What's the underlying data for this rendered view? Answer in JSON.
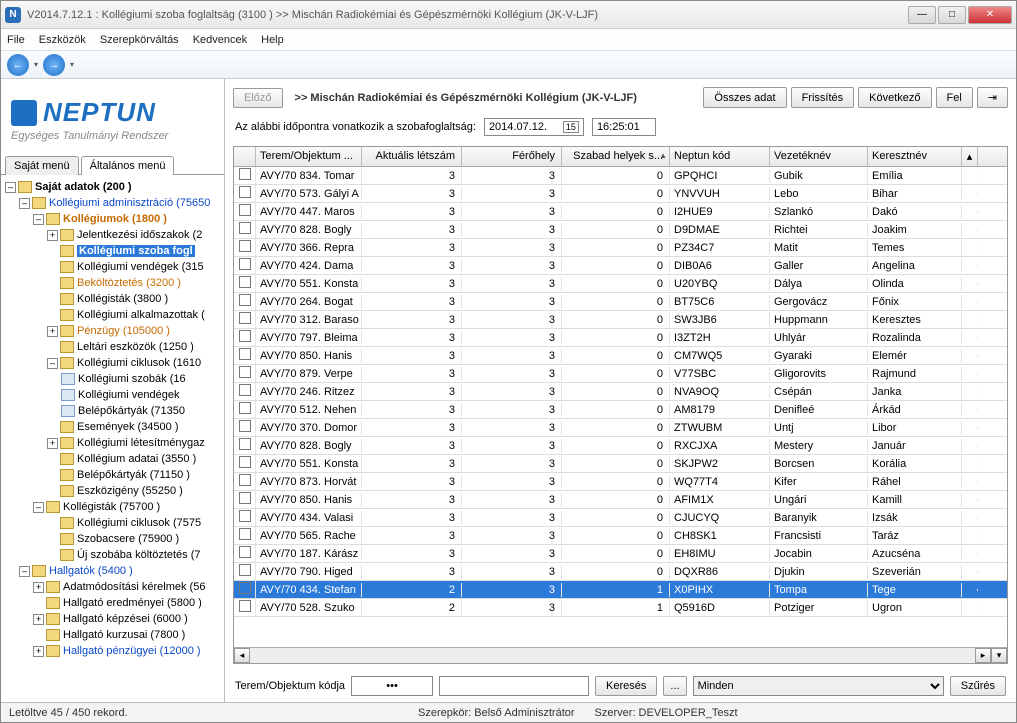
{
  "window": {
    "title": "V2014.7.12.1 : Kollégiumi szoba foglaltság (3100  )  >> Mischán Radiokémiai és Gépészmérnöki Kollégium (JK-V-LJF)"
  },
  "menu": [
    "File",
    "Eszközök",
    "Szerepkörváltás",
    "Kedvencek",
    "Help"
  ],
  "logo": {
    "brand": "NEPTUN",
    "tagline": "Egységes Tanulmányi Rendszer"
  },
  "tabs": {
    "left": "Saját menü",
    "right": "Általános menü"
  },
  "tree": {
    "root": "Saját adatok (200  )",
    "items": [
      "Kollégiumi adminisztráció (75650",
      "Kollégiumok (1800  )",
      "Jelentkezési időszakok (2",
      "Kollégiumi szoba fogl",
      "Kollégiumi vendégek (315",
      "Beköltöztetés (3200  )",
      "Kollégisták (3800  )",
      "Kollégiumi alkalmazottak (",
      "Pénzügy (105000  )",
      "Leltári eszközök (1250  )",
      "Kollégiumi ciklusok (1610",
      "Kollégiumi szobák (16",
      "Kollégiumi vendégek",
      "Belépőkártyák (71350",
      "Események (34500  )",
      "Kollégiumi létesítménygaz",
      "Kollégium adatai (3550  )",
      "Belépőkártyák (71150  )",
      "Eszközigény (55250  )",
      "Kollégisták (75700  )",
      "Kollégiumi ciklusok (7575",
      "Szobacsere (75900  )",
      "Új szobába költöztetés (7",
      "Hallgatók (5400  )",
      "Adatmódosítási kérelmek (56",
      "Hallgató eredményei (5800  )",
      "Hallgató képzései (6000  )",
      "Hallgató kurzusai (7800  )",
      "Hallgató pénzügyei (12000  )"
    ]
  },
  "header": {
    "prev": "Előző",
    "crumb": ">>  Mischán Radiokémiai és Gépészmérnöki Kollégium (JK-V-LJF)",
    "buttons": [
      "Összes adat",
      "Frissítés",
      "Következő",
      "Fel"
    ]
  },
  "dateline": {
    "label": "Az alábbi időpontra vonatkozik a szobafoglaltság:",
    "date": "2014.07.12.",
    "time": "16:25:01"
  },
  "columns": [
    "",
    "Terem/Objektum ...",
    "Aktuális létszám",
    "Férőhely",
    "Szabad helyek s...",
    "Neptun kód",
    "Vezetéknév",
    "Keresztnév"
  ],
  "rows": [
    {
      "t": "AVY/70 834. Tomar",
      "a": 3,
      "f": 3,
      "s": 0,
      "n": "GPQHCI",
      "v": "Gubik",
      "k": "Emília"
    },
    {
      "t": "AVY/70 573. Gályi A",
      "a": 3,
      "f": 3,
      "s": 0,
      "n": "YNVVUH",
      "v": "Lebo",
      "k": "Bihar"
    },
    {
      "t": "AVY/70 447. Maros",
      "a": 3,
      "f": 3,
      "s": 0,
      "n": "I2HUE9",
      "v": "Szlankó",
      "k": "Dakó"
    },
    {
      "t": "AVY/70 828. Bogly",
      "a": 3,
      "f": 3,
      "s": 0,
      "n": "D9DMAE",
      "v": "Richtei",
      "k": "Joakim"
    },
    {
      "t": "AVY/70 366. Repra",
      "a": 3,
      "f": 3,
      "s": 0,
      "n": "PZ34C7",
      "v": "Matit",
      "k": "Temes"
    },
    {
      "t": "AVY/70 424. Dama",
      "a": 3,
      "f": 3,
      "s": 0,
      "n": "DIB0A6",
      "v": "Galler",
      "k": "Angelina"
    },
    {
      "t": "AVY/70 551. Konsta",
      "a": 3,
      "f": 3,
      "s": 0,
      "n": "U20YBQ",
      "v": "Dálya",
      "k": "Olinda"
    },
    {
      "t": "AVY/70 264. Bogat",
      "a": 3,
      "f": 3,
      "s": 0,
      "n": "BT75C6",
      "v": "Gergovácz",
      "k": "Főnix"
    },
    {
      "t": "AVY/70 312. Baraso",
      "a": 3,
      "f": 3,
      "s": 0,
      "n": "SW3JB6",
      "v": "Huppmann",
      "k": "Keresztes"
    },
    {
      "t": "AVY/70 797. Bleima",
      "a": 3,
      "f": 3,
      "s": 0,
      "n": "I3ZT2H",
      "v": "Uhlyár",
      "k": "Rozalinda"
    },
    {
      "t": "AVY/70 850. Hanis",
      "a": 3,
      "f": 3,
      "s": 0,
      "n": "CM7WQ5",
      "v": "Gyaraki",
      "k": "Elemér"
    },
    {
      "t": "AVY/70 879. Verpe",
      "a": 3,
      "f": 3,
      "s": 0,
      "n": "V77SBC",
      "v": "Gligorovits",
      "k": "Rajmund"
    },
    {
      "t": "AVY/70 246. Ritzez",
      "a": 3,
      "f": 3,
      "s": 0,
      "n": "NVA9OQ",
      "v": "Csépán",
      "k": "Janka"
    },
    {
      "t": "AVY/70 512. Nehen",
      "a": 3,
      "f": 3,
      "s": 0,
      "n": "AM8179",
      "v": "Denifleé",
      "k": "Árkád"
    },
    {
      "t": "AVY/70 370. Domor",
      "a": 3,
      "f": 3,
      "s": 0,
      "n": "ZTWUBM",
      "v": "Untj",
      "k": "Libor"
    },
    {
      "t": "AVY/70 828. Bogly",
      "a": 3,
      "f": 3,
      "s": 0,
      "n": "RXCJXA",
      "v": "Mestery",
      "k": "Január"
    },
    {
      "t": "AVY/70 551. Konsta",
      "a": 3,
      "f": 3,
      "s": 0,
      "n": "SKJPW2",
      "v": "Borcsen",
      "k": "Korália"
    },
    {
      "t": "AVY/70 873. Horvát",
      "a": 3,
      "f": 3,
      "s": 0,
      "n": "WQ77T4",
      "v": "Kifer",
      "k": "Ráhel"
    },
    {
      "t": "AVY/70 850. Hanis",
      "a": 3,
      "f": 3,
      "s": 0,
      "n": "AFIM1X",
      "v": "Ungári",
      "k": "Kamill"
    },
    {
      "t": "AVY/70 434. Valasi",
      "a": 3,
      "f": 3,
      "s": 0,
      "n": "CJUCYQ",
      "v": "Baranyik",
      "k": "Izsák"
    },
    {
      "t": "AVY/70 565. Rache",
      "a": 3,
      "f": 3,
      "s": 0,
      "n": "CH8SK1",
      "v": "Francsisti",
      "k": "Taráz"
    },
    {
      "t": "AVY/70 187. Kárász",
      "a": 3,
      "f": 3,
      "s": 0,
      "n": "EH8IMU",
      "v": "Jocabin",
      "k": "Azucséna"
    },
    {
      "t": "AVY/70 790. Higed",
      "a": 3,
      "f": 3,
      "s": 0,
      "n": "DQXR86",
      "v": "Djukin",
      "k": "Szeverián"
    },
    {
      "t": "AVY/70 434. Stefan",
      "a": 2,
      "f": 3,
      "s": 1,
      "n": "X0PIHX",
      "v": "Tompa",
      "k": "Tege",
      "sel": true
    },
    {
      "t": "AVY/70 528. Szuko",
      "a": 2,
      "f": 3,
      "s": 1,
      "n": "Q5916D",
      "v": "Potziger",
      "k": "Ugron"
    }
  ],
  "footer": {
    "label": "Terem/Objektum kódja",
    "dots": "•••",
    "search": "Keresés",
    "more": "...",
    "filterSel": "Minden",
    "filter": "Szűrés"
  },
  "status": {
    "left": "Letöltve 45 / 450 rekord.",
    "role": "Szerepkör: Belső Adminisztrátor",
    "server": "Szerver: DEVELOPER_Teszt"
  }
}
